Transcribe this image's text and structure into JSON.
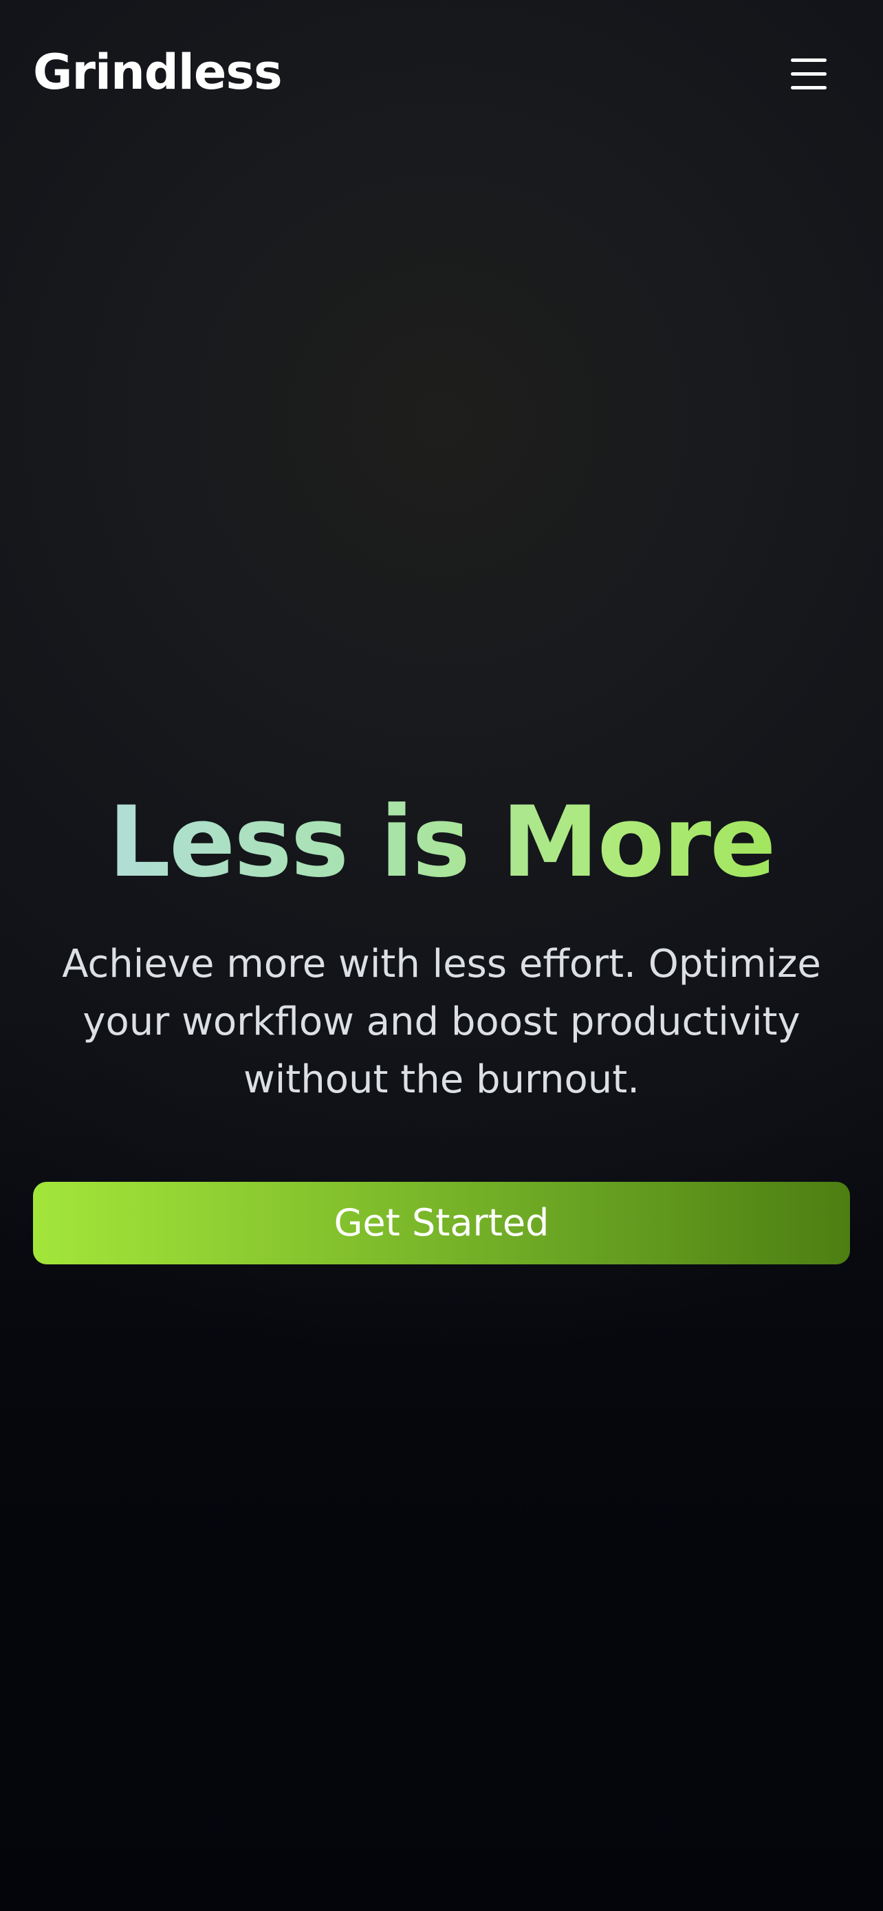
{
  "header": {
    "logo_text": "Grindless",
    "menu_icon": "hamburger-menu-icon"
  },
  "hero": {
    "title": "Less is More",
    "subtitle": "Achieve more with less effort. Optimize your workflow and boost productivity without the burnout.",
    "cta_label": "Get Started"
  },
  "colors": {
    "background": "#0b0d13",
    "title_gradient_start": "#b4dce6",
    "title_gradient_end": "#99e24a",
    "cta_gradient_start": "#a3e63a",
    "cta_gradient_end": "#4d7e12",
    "text_primary": "#ffffff",
    "text_secondary": "#dcdfe4"
  }
}
